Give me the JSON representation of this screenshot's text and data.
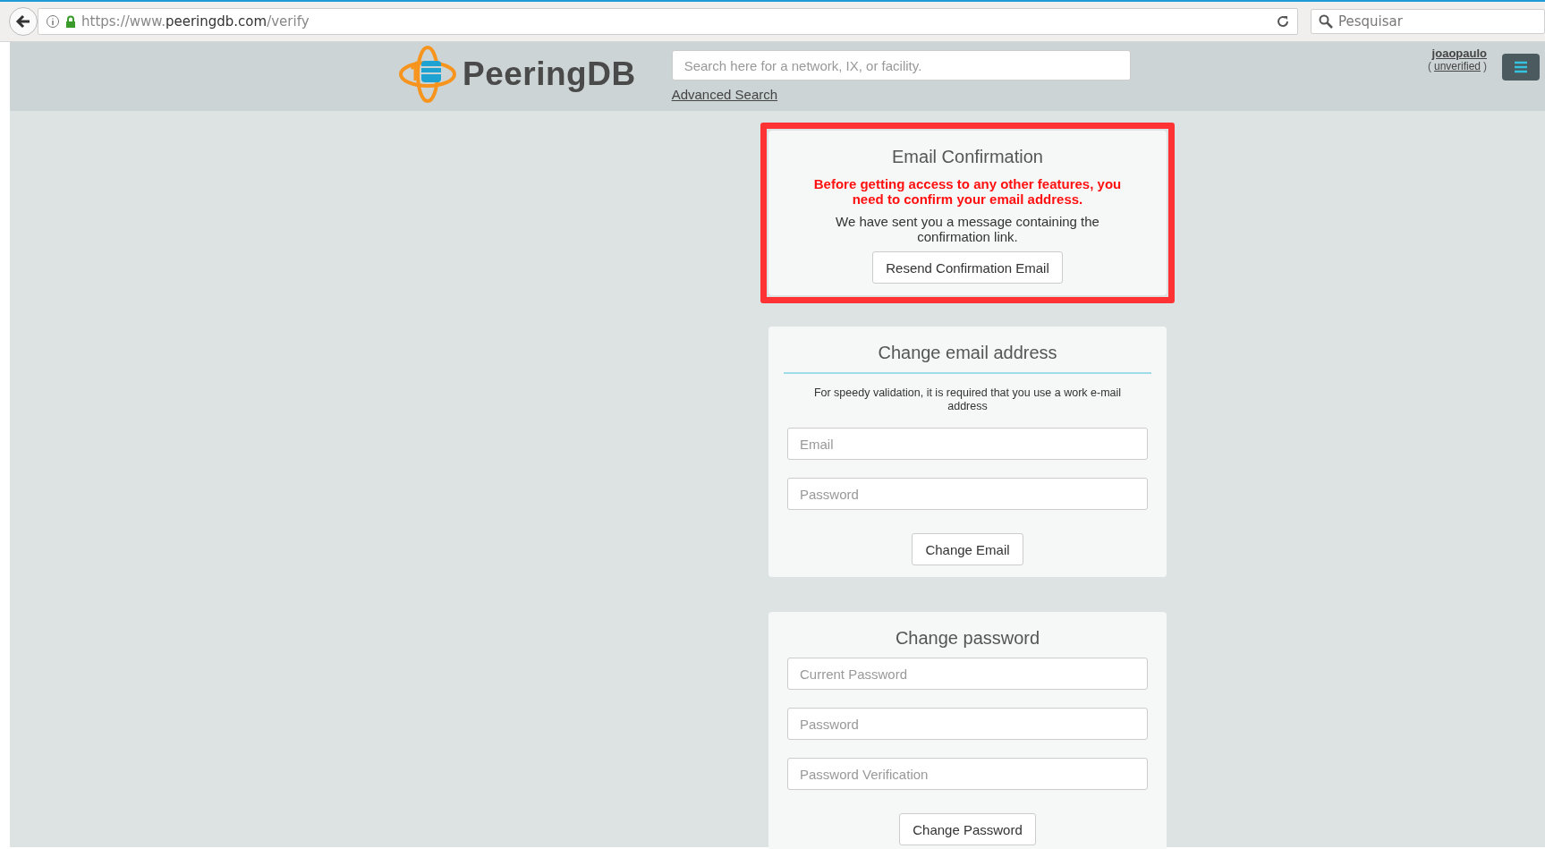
{
  "browser": {
    "url": {
      "prefix": "https://www.",
      "domain": "peeringdb.com",
      "path": "/verify"
    },
    "search_placeholder": "Pesquisar"
  },
  "header": {
    "logo": "PeeringDB",
    "search_placeholder": "Search here for a network, IX, or facility.",
    "advanced_search": "Advanced Search",
    "user": {
      "name": "joaopaulo",
      "status_prefix": "(",
      "status": "unverified",
      "status_suffix": ")"
    }
  },
  "cards": [
    {
      "kind": "confirmation",
      "highlighted": true,
      "title": "Email Confirmation",
      "alert": "Before getting access to any other features, you need to confirm your email address.",
      "message": "We have sent you a message containing the confirmation link.",
      "button": "Resend Confirmation Email"
    },
    {
      "kind": "form",
      "highlighted": false,
      "title": "Change email address",
      "note": "For speedy validation, it is required that you use a work e-mail address",
      "fields": [
        {
          "placeholder": "Email"
        },
        {
          "placeholder": "Password"
        }
      ],
      "button": "Change Email"
    },
    {
      "kind": "form",
      "highlighted": false,
      "title": "Change password",
      "fields": [
        {
          "placeholder": "Current Password"
        },
        {
          "placeholder": "Password"
        },
        {
          "placeholder": "Password Verification"
        }
      ],
      "button": "Change Password"
    }
  ]
}
